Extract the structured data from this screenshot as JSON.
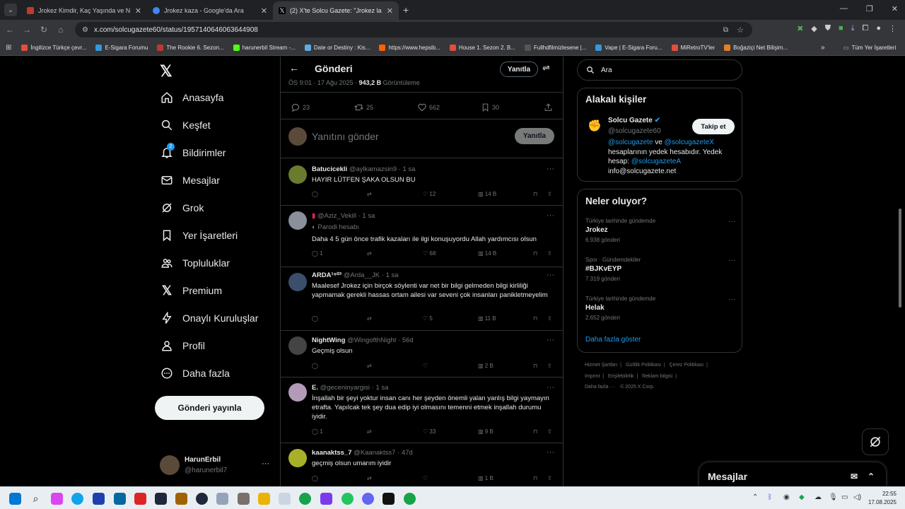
{
  "browser": {
    "tabs": [
      {
        "title": "Jrokez Kimdir, Kaç Yaşında ve N",
        "favicon_color": "#c0392b"
      },
      {
        "title": "Jrokez kaza - Google'da Ara",
        "favicon_color": "#4285f4"
      },
      {
        "title": "(2) X'te Solcu Gazete: \"Jrokez la",
        "favicon_color": "#ffffff"
      }
    ],
    "new_tab": "+",
    "url": "x.com/solcugazete60/status/1957140646063644908",
    "bookmarks": [
      {
        "label": "İngilizce Türkçe çevr...",
        "color": "#e74c3c"
      },
      {
        "label": "E-Sigara Forumu",
        "color": "#3498db"
      },
      {
        "label": "The Rookie 6. Sezon...",
        "color": "#c0392b"
      },
      {
        "label": "harunerbil Stream -...",
        "color": "#53fc18"
      },
      {
        "label": "Date or Destiny : Kis...",
        "color": "#5dade2"
      },
      {
        "label": "https://www.hepsib...",
        "color": "#ff6000"
      },
      {
        "label": "House 1. Sezon 2. B...",
        "color": "#e74c3c"
      },
      {
        "label": "Fullhdfilmizlesene |...",
        "color": "#555555"
      },
      {
        "label": "Vape | E-Sigara Foru...",
        "color": "#3498db"
      },
      {
        "label": "MiRetroTV'ler",
        "color": "#e74c3c"
      },
      {
        "label": "Boğaziçi Net Bilişim...",
        "color": "#e67e22"
      }
    ],
    "bookmarks_more": "»",
    "all_bookmarks": "Tüm Yer İşaretleri"
  },
  "sidebar": {
    "items": [
      {
        "label": "Anasayfa",
        "icon": "home-icon"
      },
      {
        "label": "Keşfet",
        "icon": "search-icon"
      },
      {
        "label": "Bildirimler",
        "icon": "bell-icon",
        "badge": "2"
      },
      {
        "label": "Mesajlar",
        "icon": "mail-icon"
      },
      {
        "label": "Grok",
        "icon": "grok-icon"
      },
      {
        "label": "Yer İşaretleri",
        "icon": "bookmark-icon"
      },
      {
        "label": "Topluluklar",
        "icon": "communities-icon"
      },
      {
        "label": "Premium",
        "icon": "x-logo-icon"
      },
      {
        "label": "Onaylı Kuruluşlar",
        "icon": "lightning-icon"
      },
      {
        "label": "Profil",
        "icon": "person-icon"
      },
      {
        "label": "Daha fazla",
        "icon": "more-circle-icon"
      }
    ],
    "post_button": "Gönderi yayınla",
    "account": {
      "name": "HarunErbil",
      "handle": "@harunerbil7",
      "more": "···"
    }
  },
  "header": {
    "title": "Gönderi",
    "reply_button": "Yanıtla"
  },
  "tweet": {
    "meta_time": "ÖS 9:01 · 17 Ağu 2025 · ",
    "views": "943,2 B",
    "views_label": "Görüntüleme",
    "replies": "23",
    "retweets": "25",
    "likes": "662",
    "bookmarks": "30"
  },
  "composer": {
    "placeholder": "Yanıtını gönder",
    "button": "Yanıtla"
  },
  "replies": [
    {
      "name": "Batucicekli",
      "handle": "@aylkamazsin9",
      "time": "1 sa",
      "badge": "",
      "text": "HAYIR LÜTFEN ŞAKA OLSUN BU",
      "replies": "",
      "retweets": "",
      "likes": "12",
      "views": "14 B",
      "avatar_color": "#6a7b2e"
    },
    {
      "name": "",
      "handle": "@Aziz_Vekill",
      "time": "1 sa",
      "badge": "Parodi hesabı",
      "text": "Daha 4 5 gün önce trafik kazaları ile ilgi konuşuyordu Allah yardımcısı olsun",
      "replies": "1",
      "retweets": "",
      "likes": "68",
      "views": "14 B",
      "avatar_color": "#8a8f99"
    },
    {
      "name": "ARDA¹⁹⁰³",
      "handle": "@Arda__JK",
      "time": "1 sa",
      "badge": "",
      "text": "Maalesef Jrokez için birçok söylenti var net bir bilgi gelmeden bilgi kirliliği yapmamak gerekli hassas ortam ailesi var seveni çok insanları panikletmeyelim",
      "replies": "",
      "retweets": "",
      "likes": "5",
      "views": "11 B",
      "avatar_color": "#3b4f6b"
    },
    {
      "name": "NightWing",
      "handle": "@WingofthNight",
      "time": "56d",
      "badge": "",
      "text": "Geçmiş olsun",
      "replies": "",
      "retweets": "",
      "likes": "",
      "views": "2 B",
      "avatar_color": "#444444"
    },
    {
      "name": "E.",
      "handle": "@geceninyargisi",
      "time": "1 sa",
      "badge": "",
      "text": "İnşallah bir şeyi yoktur insan canı her şeyden önemli yalan yanlış bilgi yaymayın etrafta. Yapılcak tek şey dua edip iyi olmasını temenni etmek inşallah durumu iyidir.",
      "replies": "1",
      "retweets": "",
      "likes": "33",
      "views": "9 B",
      "avatar_color": "#b39ab8"
    },
    {
      "name": "kaanaktss_7",
      "handle": "@Kaanaktss7",
      "time": "47d",
      "badge": "",
      "text": "geçmiş olsun umarım iyidir",
      "replies": "",
      "retweets": "",
      "likes": "",
      "views": "1 B",
      "avatar_color": "#a8b02a"
    }
  ],
  "search": {
    "placeholder": "Ara"
  },
  "related": {
    "title": "Alakalı kişiler",
    "name": "Solcu Gazete",
    "handle": "@solcugazete60",
    "follow": "Takip et",
    "bio_link1": "@solcugazete",
    "bio_and": " ve ",
    "bio_link2": "@solcugazeteX",
    "bio_rest": " hesaplarının yedek hesabıdır. Yedek hesap: ",
    "bio_link3": "@solcugazeteA",
    "bio_email": "info@solcugazete.net"
  },
  "trends": {
    "title": "Neler oluyor?",
    "items": [
      {
        "category": "Türkiye tarihinde gündemde",
        "name": "Jrokez",
        "count": "6.938 gönderi"
      },
      {
        "category": "Spor · Gündemdekiler",
        "name": "#BJKvEYP",
        "count": "7.319 gönderi"
      },
      {
        "category": "Türkiye tarihinde gündemde",
        "name": "Helak",
        "count": "2.652 gönderi"
      }
    ],
    "show_more": "Daha fazla göster"
  },
  "footer": {
    "links": [
      "Hizmet Şartları",
      "Gizlilik Politikası",
      "Çerez Politikası",
      "Imprint",
      "Erişilebilirlik",
      "Reklam bilgisi",
      "Daha fazla ···"
    ],
    "copyright": "© 2025 X Corp."
  },
  "messages_drawer": {
    "title": "Mesajlar"
  },
  "taskbar": {
    "time": "22:55",
    "date": "17.08.2025"
  },
  "colors": {
    "accent": "#1d9bf0",
    "text": "#e7e9ea",
    "muted": "#71767b",
    "border": "#2f3336"
  }
}
